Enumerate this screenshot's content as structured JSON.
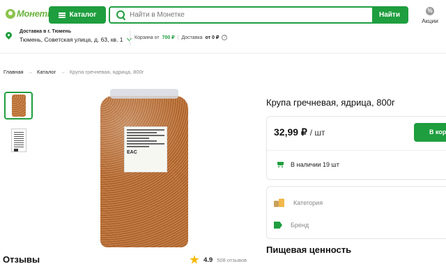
{
  "header": {
    "logo_text": "Монетка",
    "catalog_label": "Каталог",
    "search_placeholder": "Найти в Монетке",
    "search_button": "Найти",
    "promo_label": "Акции"
  },
  "delivery": {
    "title": "Доставка в г. Тюмень",
    "address": "Тюмень, Советская улица, д. 63, кв. 1"
  },
  "limits": {
    "cart_prefix": "Корзина от",
    "cart_value": "700 ₽",
    "delivery_prefix": "Доставка",
    "delivery_value": "от 0 ₽"
  },
  "breadcrumb": {
    "home": "Главная",
    "catalog": "Каталог",
    "current": "Крупа гречневая, ядрица, 800г"
  },
  "product": {
    "title": "Крупа гречневая, ядрица, 800г",
    "price": "32,99 ₽",
    "price_unit": "/ шт",
    "cart_button": "В корзину",
    "stock": "В наличии 19 шт",
    "category_label": "Категория",
    "brand_label": "Бренд",
    "nutrition_title": "Пищевая ценность",
    "label_mark": "EAC"
  },
  "reviews": {
    "title": "Отзывы",
    "rating": "4.9",
    "count": "508 отзывов"
  },
  "colors": {
    "brand_green": "#1e9e3e",
    "star": "#f5b800"
  }
}
